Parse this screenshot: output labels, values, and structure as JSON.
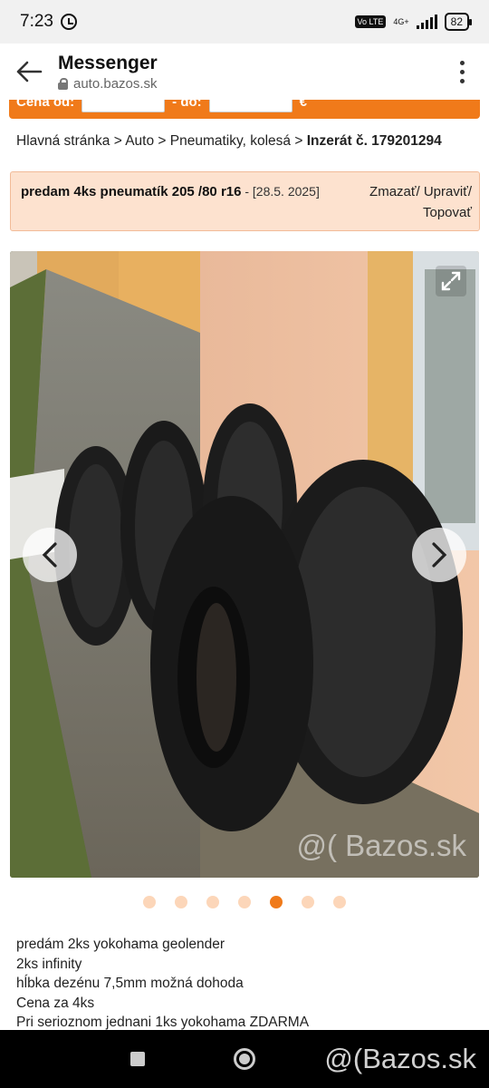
{
  "status_bar": {
    "time": "7:23",
    "volte": "Vo LTE",
    "network": "4G+",
    "battery": "82"
  },
  "app_bar": {
    "title": "Messenger",
    "url": "auto.bazos.sk"
  },
  "search_strip": {
    "from_label": "Cena od:",
    "to_label": "- do:",
    "currency": "€"
  },
  "breadcrumb": {
    "home": "Hlavná stránka",
    "sep1": " > ",
    "auto": "Auto",
    "sep2": " > ",
    "category": "Pneumatiky, kolesá",
    "sep3": " > ",
    "current": "Inzerát č. 179201294"
  },
  "listing": {
    "title": "predam 4ks pneumatík 205 /80 r16",
    "date": " - [28.5. 2025]",
    "actions": "Zmazať/ Upraviť/ Topovať"
  },
  "gallery": {
    "total_images": 7,
    "active_index": 5,
    "watermark": "@( Bazos.sk"
  },
  "description": [
    "predám 2ks yokohama geolender",
    "2ks infinity",
    "hĺbka dezénu 7,5mm možná dohoda",
    "Cena za 4ks",
    "Pri serioznom jednani 1ks yokohama ZDARMA"
  ],
  "overlay_watermark": "@(Bazos.sk",
  "colors": {
    "accent": "#f07a1a",
    "listing_bg": "#fde2cf"
  },
  "icons": {
    "back": "back-arrow-icon",
    "lock": "lock-icon",
    "menu": "more-vert-icon",
    "expand": "expand-icon",
    "prev": "chevron-left-icon",
    "next": "chevron-right-icon"
  }
}
